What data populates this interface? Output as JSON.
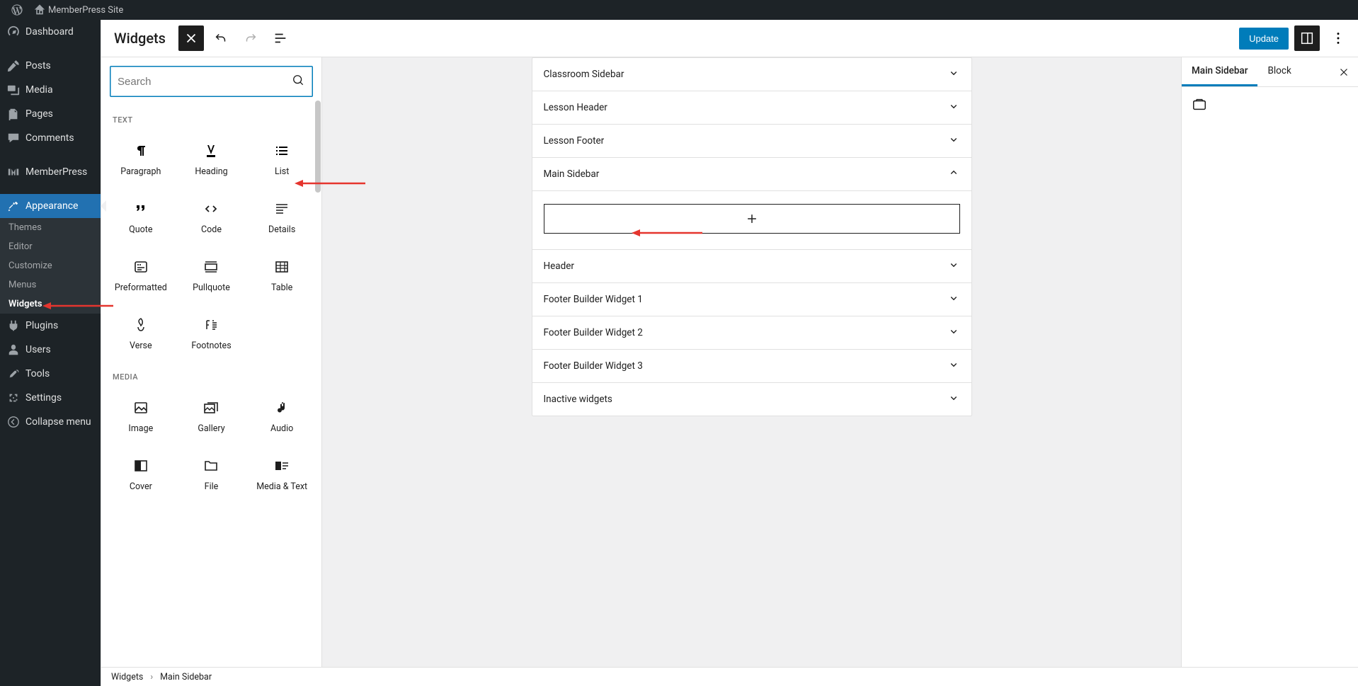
{
  "adminbar": {
    "site_name": "MemberPress Site"
  },
  "adminmenu": {
    "dashboard": "Dashboard",
    "posts": "Posts",
    "media": "Media",
    "pages": "Pages",
    "comments": "Comments",
    "memberpress": "MemberPress",
    "appearance": "Appearance",
    "appearance_sub": {
      "themes": "Themes",
      "editor": "Editor",
      "customize": "Customize",
      "menus": "Menus",
      "widgets": "Widgets"
    },
    "plugins": "Plugins",
    "users": "Users",
    "tools": "Tools",
    "settings": "Settings",
    "collapse": "Collapse menu"
  },
  "editor": {
    "title": "Widgets",
    "update_label": "Update",
    "search_placeholder": "Search"
  },
  "inserter": {
    "cat_text": "TEXT",
    "cat_media": "MEDIA",
    "blocks_text": {
      "paragraph": "Paragraph",
      "heading": "Heading",
      "list": "List",
      "quote": "Quote",
      "code": "Code",
      "details": "Details",
      "preformatted": "Preformatted",
      "pullquote": "Pullquote",
      "table": "Table",
      "verse": "Verse",
      "footnotes": "Footnotes"
    },
    "blocks_media": {
      "image": "Image",
      "gallery": "Gallery",
      "audio": "Audio",
      "cover": "Cover",
      "file": "File",
      "media_text": "Media & Text"
    }
  },
  "widget_areas": [
    {
      "label": "Classroom Sidebar",
      "open": false
    },
    {
      "label": "Lesson Header",
      "open": false
    },
    {
      "label": "Lesson Footer",
      "open": false
    },
    {
      "label": "Main Sidebar",
      "open": true
    },
    {
      "label": "Header",
      "open": false
    },
    {
      "label": "Footer Builder Widget 1",
      "open": false
    },
    {
      "label": "Footer Builder Widget 2",
      "open": false
    },
    {
      "label": "Footer Builder Widget 3",
      "open": false
    },
    {
      "label": "Inactive widgets",
      "open": false
    }
  ],
  "settings": {
    "tab_area": "Main Sidebar",
    "tab_block": "Block"
  },
  "breadcrumb": {
    "root": "Widgets",
    "current": "Main Sidebar"
  }
}
